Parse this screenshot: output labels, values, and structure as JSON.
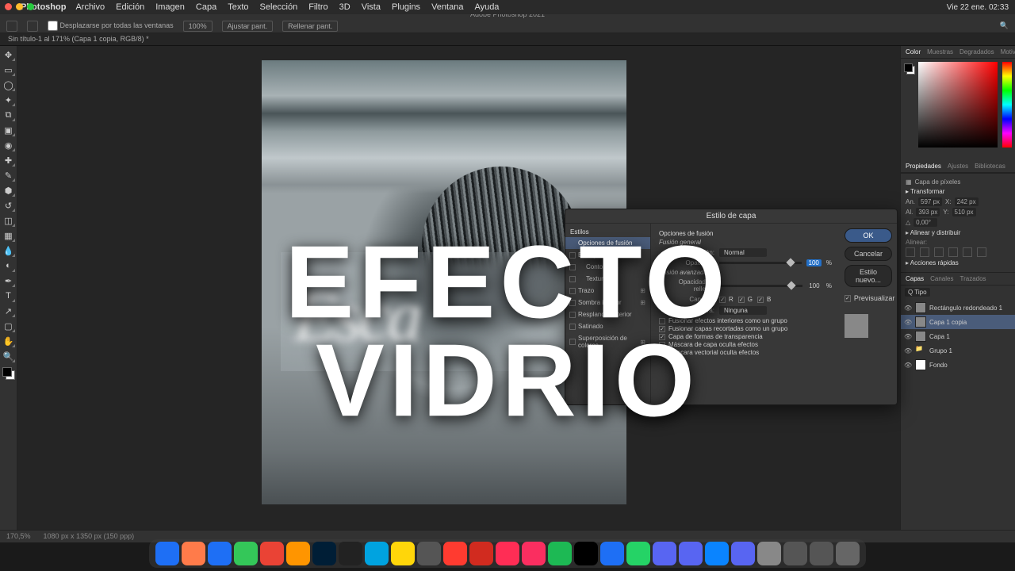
{
  "mac": {
    "app": "Photoshop",
    "menu": [
      "Archivo",
      "Edición",
      "Imagen",
      "Capa",
      "Texto",
      "Selección",
      "Filtro",
      "3D",
      "Vista",
      "Plugins",
      "Ventana",
      "Ayuda"
    ],
    "clock": "Vie 22 ene. 02:33"
  },
  "window": {
    "title": "Adobe Photoshop 2021",
    "tab": "Sin título-1 al 171% (Capa 1 copia, RGB/8) *"
  },
  "options": {
    "scroll": "Desplazarse por todas las ventanas",
    "zoom100": "100%",
    "fit": "Ajustar pant.",
    "fill": "Rellenar pant."
  },
  "status": {
    "zoom": "170,5%",
    "info": "1080 px x 1350 px (150 ppp)"
  },
  "panels": {
    "color": {
      "tabs": [
        "Color",
        "Muestras",
        "Degradados",
        "Motivos"
      ]
    },
    "props": {
      "tabs": [
        "Propiedades",
        "Ajustes",
        "Bibliotecas"
      ],
      "type": "Capa de píxeles",
      "transform": "Transformar",
      "w": "An.",
      "wval": "597 px",
      "x": "X:",
      "xval": "242 px",
      "h": "Al.",
      "hval": "393 px",
      "y": "Y:",
      "yval": "510 px",
      "ang": "0,00°"
    },
    "align": {
      "title": "Alinear y distribuir",
      "sub": "Alinear:"
    },
    "quick": {
      "title": "Acciones rápidas"
    },
    "layers": {
      "tabs": [
        "Capas",
        "Canales",
        "Trazados"
      ],
      "items": [
        {
          "name": "Rectángulo redondeado 1",
          "sel": false
        },
        {
          "name": "Capa 1 copia",
          "sel": true
        },
        {
          "name": "Capa 1",
          "sel": false
        },
        {
          "name": "Grupo 1",
          "sel": false,
          "folder": true
        },
        {
          "name": "Fondo",
          "sel": false,
          "white": true
        }
      ]
    }
  },
  "dialog": {
    "title": "Estilo de capa",
    "left": {
      "header": "Estilos",
      "options_header": "Opciones de fusión",
      "items": [
        {
          "label": "Bisel y relieve"
        },
        {
          "label": "Contorno",
          "indent": true
        },
        {
          "label": "Textura",
          "indent": true
        },
        {
          "label": "Trazo",
          "plus": true
        },
        {
          "label": "Sombra interior",
          "plus": true
        },
        {
          "label": "Resplandor interior"
        },
        {
          "label": "Satinado"
        },
        {
          "label": "Superposición de colores",
          "plus": true
        }
      ]
    },
    "mid": {
      "h1": "Opciones de fusión",
      "sub1": "Fusión general",
      "mode_label": "Modo de fusión:",
      "mode_value": "Normal",
      "op_label": "Opacidad:",
      "op_value": "100",
      "pct": "%",
      "sub2": "Fusión avanzada",
      "fill_label": "Opacidad de relleno:",
      "fill_value": "100",
      "ch_label": "Canales:",
      "ch_r": "R",
      "ch_g": "G",
      "ch_b": "B",
      "cov_label": "Cobertura:",
      "cov_value": "Ninguna",
      "chk1": "Fusionar efectos interiores como un grupo",
      "chk2": "Fusionar capas recortadas como un grupo",
      "chk3": "Capa de formas de transparencia",
      "chk4": "Máscara de capa oculta efectos",
      "chk5": "Máscara vectorial oculta efectos"
    },
    "right": {
      "ok": "OK",
      "cancel": "Cancelar",
      "new_style": "Estilo nuevo...",
      "preview": "Previsualizar"
    }
  },
  "overlay": {
    "line1": "EFECTO",
    "line2": "VIDRIO"
  },
  "artboard": {
    "script": "Esca"
  },
  "dock_colors": [
    "#1e6ff5",
    "#ff7b4a",
    "#1e6ff5",
    "#34c759",
    "#ea4335",
    "#ff9500",
    "#001e36",
    "#222",
    "#00a3e0",
    "#ffd60a",
    "#555",
    "#ff3b30",
    "#d12b1f",
    "#ff2d55",
    "#fa2e60",
    "#1db954",
    "#000",
    "#1e6ff5",
    "#25d366",
    "#5865f2",
    "#5865f2",
    "#0a84ff",
    "#5865f2",
    "#888",
    "#555",
    "#555",
    "#666"
  ]
}
